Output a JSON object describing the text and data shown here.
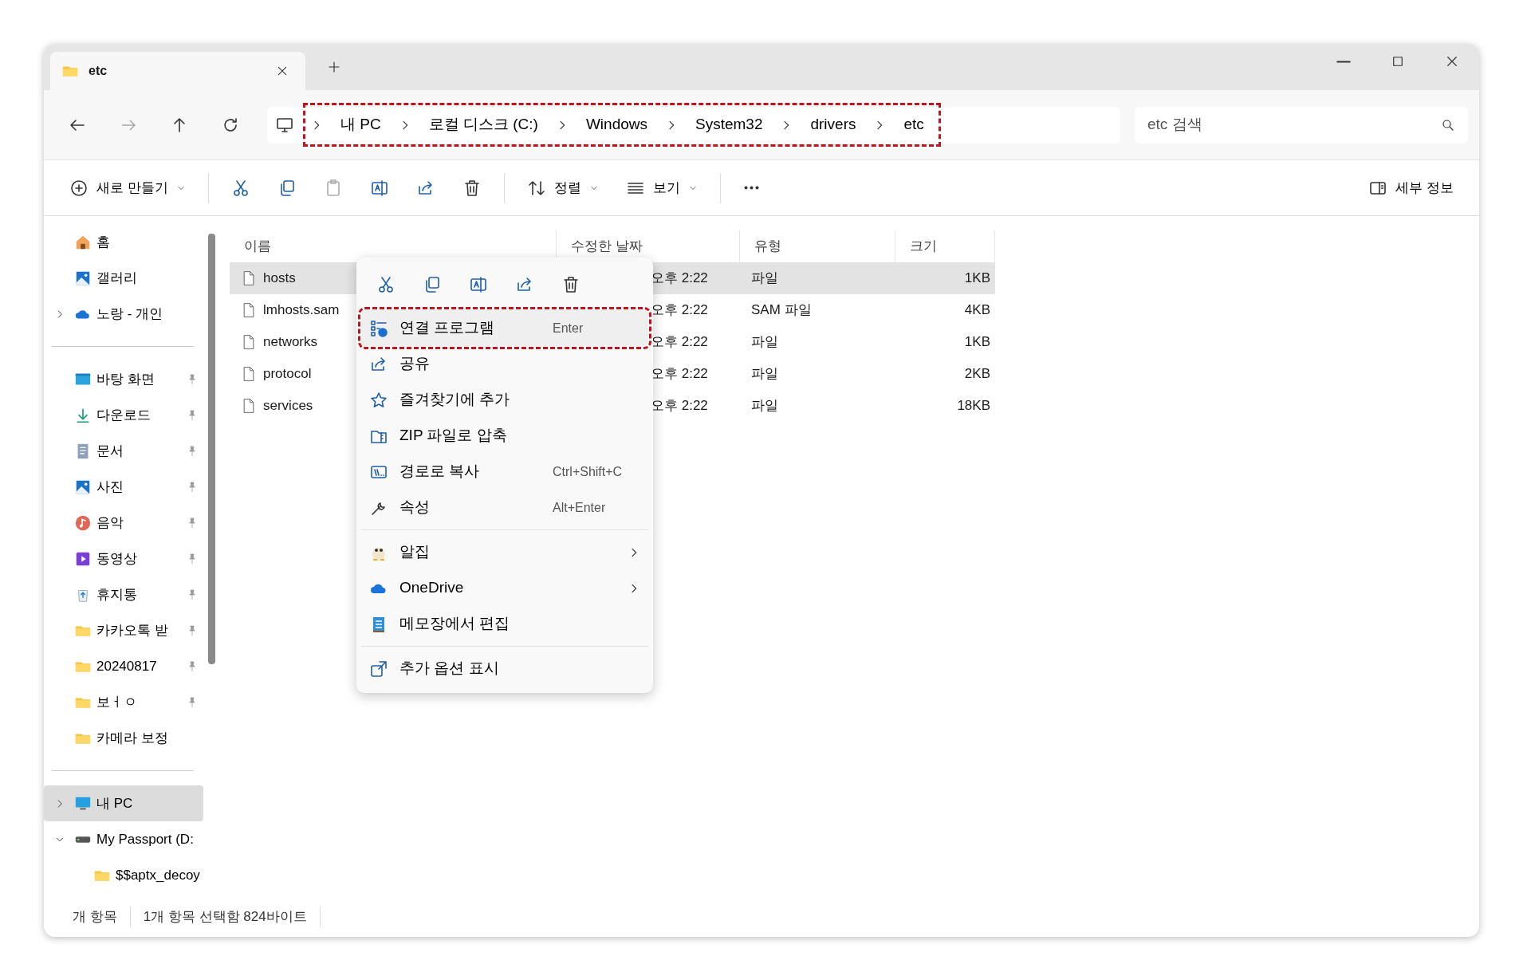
{
  "tab": {
    "title": "etc"
  },
  "breadcrumb": {
    "highlighted": true,
    "items": [
      "내 PC",
      "로컬 디스크 (C:)",
      "Windows",
      "System32",
      "drivers",
      "etc"
    ]
  },
  "search": {
    "placeholder": "etc 검색"
  },
  "toolbar": {
    "new_label": "새로 만들기",
    "sort_label": "정렬",
    "view_label": "보기",
    "details_label": "세부 정보"
  },
  "sidebar": {
    "groups": [
      [
        {
          "label": "홈",
          "kind": "home",
          "pinned": false,
          "selected": false
        },
        {
          "label": "갤러리",
          "kind": "gallery",
          "pinned": false,
          "selected": false
        },
        {
          "label": "노랑 - 개인",
          "kind": "cloud",
          "pinned": false,
          "selected": false,
          "expanded": false
        }
      ],
      [
        {
          "label": "바탕 화면",
          "kind": "desktop",
          "pinned": true,
          "selected": false
        },
        {
          "label": "다운로드",
          "kind": "download",
          "pinned": true,
          "selected": false
        },
        {
          "label": "문서",
          "kind": "document",
          "pinned": true,
          "selected": false
        },
        {
          "label": "사진",
          "kind": "gallery",
          "pinned": true,
          "selected": false
        },
        {
          "label": "음악",
          "kind": "music",
          "pinned": true,
          "selected": false
        },
        {
          "label": "동영상",
          "kind": "video",
          "pinned": true,
          "selected": false
        },
        {
          "label": "휴지통",
          "kind": "recycle",
          "pinned": true,
          "selected": false
        },
        {
          "label": "카카오톡 받",
          "kind": "folder",
          "pinned": true,
          "selected": false
        },
        {
          "label": "20240817",
          "kind": "folder",
          "pinned": true,
          "selected": false
        },
        {
          "label": "보ㅓㅇ",
          "kind": "folder",
          "pinned": true,
          "selected": false
        },
        {
          "label": "카메라 보정",
          "kind": "folder",
          "pinned": false,
          "selected": false
        }
      ],
      [
        {
          "label": "내 PC",
          "kind": "pc",
          "pinned": false,
          "selected": true,
          "expanded": false
        },
        {
          "label": "My Passport (D:",
          "kind": "drive",
          "pinned": false,
          "selected": false,
          "expanded": true,
          "children": [
            {
              "label": "$$aptx_decoy",
              "kind": "folder",
              "pinned": false,
              "selected": false
            }
          ]
        }
      ]
    ]
  },
  "table": {
    "columns": [
      "이름",
      "수정한 날짜",
      "유형",
      "크기"
    ],
    "rows": [
      {
        "name": "hosts",
        "modified": "오후 2:22",
        "type": "파일",
        "size": "1KB",
        "selected": true
      },
      {
        "name": "lmhosts.sam",
        "modified": "오후 2:22",
        "type": "SAM 파일",
        "size": "4KB",
        "selected": false
      },
      {
        "name": "networks",
        "modified": "오후 2:22",
        "type": "파일",
        "size": "1KB",
        "selected": false
      },
      {
        "name": "protocol",
        "modified": "오후 2:22",
        "type": "파일",
        "size": "2KB",
        "selected": false
      },
      {
        "name": "services",
        "modified": "오후 2:22",
        "type": "파일",
        "size": "18KB",
        "selected": false
      }
    ]
  },
  "context_menu": {
    "quick_actions": [
      {
        "kind": "cut"
      },
      {
        "kind": "copy"
      },
      {
        "kind": "rename"
      },
      {
        "kind": "share"
      },
      {
        "kind": "delete"
      }
    ],
    "groups": [
      [
        {
          "kind": "openwith",
          "label": "연결 프로그램",
          "shortcut": "Enter",
          "highlighted": true,
          "submenu": false
        },
        {
          "kind": "share",
          "label": "공유",
          "highlighted": false,
          "submenu": false
        },
        {
          "kind": "star",
          "label": "즐겨찾기에 추가",
          "highlighted": false,
          "submenu": false
        },
        {
          "kind": "zip",
          "label": "ZIP 파일로 압축",
          "highlighted": false,
          "submenu": false
        },
        {
          "kind": "path",
          "label": "경로로 복사",
          "shortcut": "Ctrl+Shift+C",
          "highlighted": false,
          "submenu": false
        },
        {
          "kind": "wrench",
          "label": "속성",
          "shortcut": "Alt+Enter",
          "highlighted": false,
          "submenu": false
        }
      ],
      [
        {
          "kind": "egg",
          "label": "알집",
          "highlighted": false,
          "submenu": true
        },
        {
          "kind": "cloud",
          "label": "OneDrive",
          "highlighted": false,
          "submenu": true
        },
        {
          "kind": "notepad",
          "label": "메모장에서 편집",
          "highlighted": false,
          "submenu": false
        }
      ],
      [
        {
          "kind": "more",
          "label": "추가 옵션 표시",
          "highlighted": false,
          "submenu": false
        }
      ]
    ]
  },
  "status_bar": {
    "items": [
      "개 항목",
      "1개 항목 선택함 824바이트"
    ]
  }
}
